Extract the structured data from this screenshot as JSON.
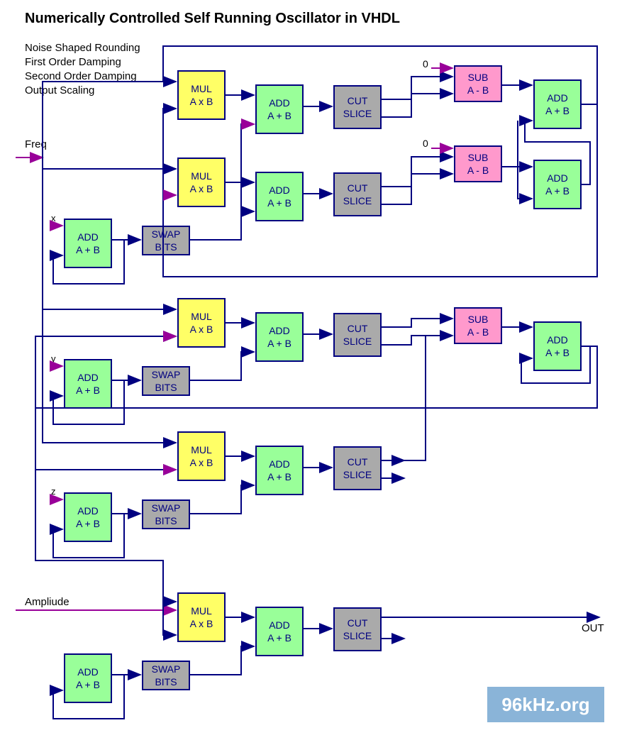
{
  "title": "Numerically Controlled Self Running Oscillator in VHDL",
  "notes": {
    "n1": "Noise Shaped Rounding",
    "n2": "First Order Damping",
    "n3": "Second Order Damping",
    "n4": "Output Scaling"
  },
  "labels": {
    "freq": "Freq",
    "amplitude": "Ampliude",
    "out": "OUT",
    "x": "x",
    "y": "y",
    "z": "z",
    "zero1": "0",
    "zero2": "0"
  },
  "blocks": {
    "mul": {
      "l1": "MUL",
      "l2": "A x B"
    },
    "add": {
      "l1": "ADD",
      "l2": "A + B"
    },
    "sub": {
      "l1": "SUB",
      "l2": "A - B"
    },
    "cut": {
      "l1": "CUT",
      "l2": "SLICE"
    },
    "swap": {
      "l1": "SWAP",
      "l2": "BITS"
    }
  },
  "logo": "96kHz.org"
}
